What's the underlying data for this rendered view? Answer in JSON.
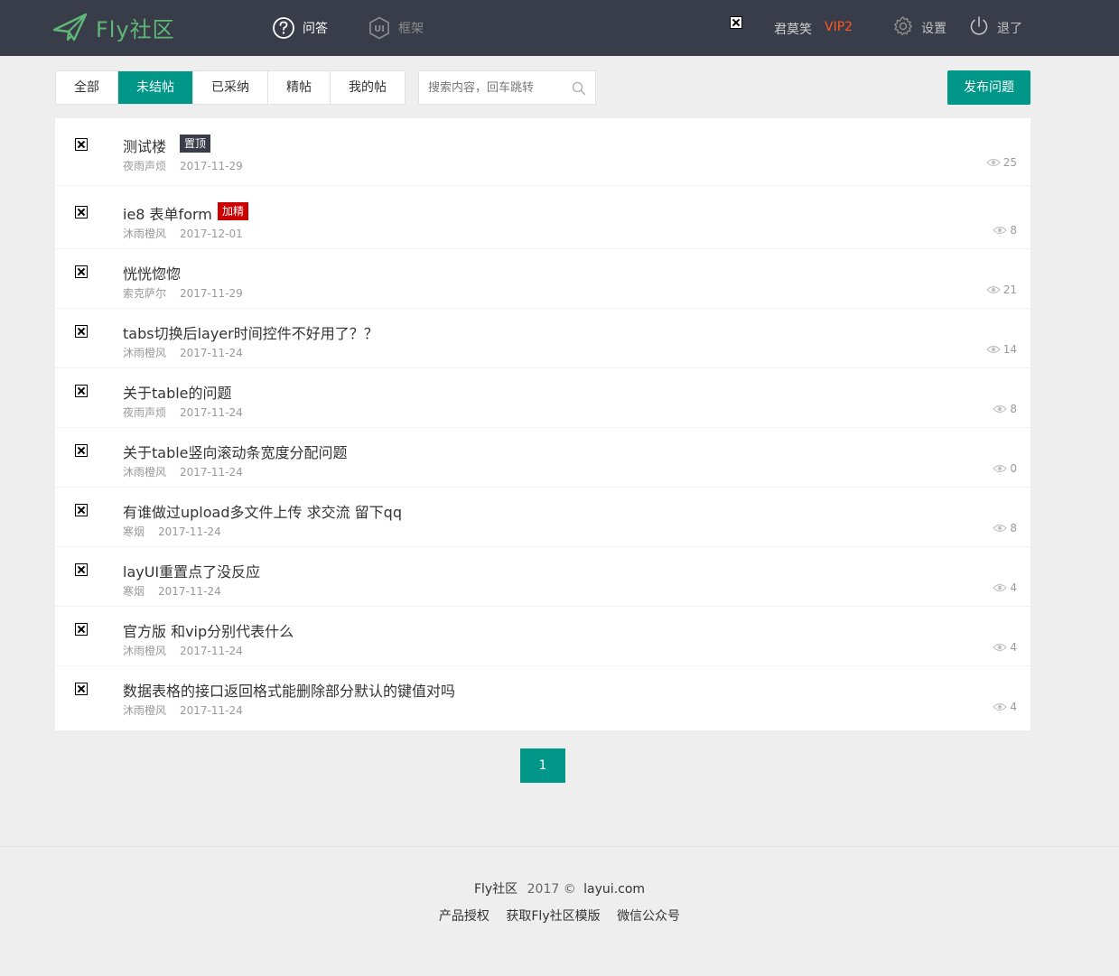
{
  "header": {
    "logo_text": "Fly社区",
    "nav": {
      "qa": "问答",
      "framework": "框架"
    },
    "user": {
      "name": "君莫笑",
      "vip": "VIP2"
    },
    "settings": "设置",
    "logout": "退了"
  },
  "filters": {
    "tabs": [
      "全部",
      "未结帖",
      "已采纳",
      "精帖",
      "我的帖"
    ],
    "active_tab": "未结帖",
    "search_placeholder": "搜索内容，回车跳转",
    "post_button": "发布问题"
  },
  "posts": [
    {
      "title": "测试楼",
      "badge": "置顶",
      "badge_type": "top",
      "author": "夜雨声烦",
      "date": "2017-11-29",
      "views": "25"
    },
    {
      "title": "ie8 表单form",
      "badge": "加精",
      "badge_type": "fine",
      "author": "沐雨橙风",
      "date": "2017-12-01",
      "views": "8"
    },
    {
      "title": "恍恍惚惚",
      "author": "索克萨尔",
      "date": "2017-11-29",
      "views": "21"
    },
    {
      "title": "tabs切换后layer时间控件不好用了？？",
      "author": "沐雨橙风",
      "date": "2017-11-24",
      "views": "14"
    },
    {
      "title": "关于table的问题",
      "author": "夜雨声烦",
      "date": "2017-11-24",
      "views": "8"
    },
    {
      "title": "关于table竖向滚动条宽度分配问题",
      "author": "沐雨橙风",
      "date": "2017-11-24",
      "views": "0"
    },
    {
      "title": "有谁做过upload多文件上传 求交流 留下qq",
      "author": "寒烟",
      "date": "2017-11-24",
      "views": "8"
    },
    {
      "title": "layUI重置点了没反应",
      "author": "寒烟",
      "date": "2017-11-24",
      "views": "4"
    },
    {
      "title": "官方版 和vip分别代表什么",
      "author": "沐雨橙风",
      "date": "2017-11-24",
      "views": "4"
    },
    {
      "title": "数据表格的接口返回格式能删除部分默认的键值对吗",
      "author": "沐雨橙风",
      "date": "2017-11-24",
      "views": "4"
    }
  ],
  "pager": {
    "current": "1"
  },
  "footer": {
    "site": "Fly社区",
    "year": "2017 ©",
    "domain": "layui.com",
    "links": [
      "产品授权",
      "获取Fly社区模版",
      "微信公众号"
    ]
  },
  "colors": {
    "header_bg": "#393d49",
    "accent": "#009688",
    "logo": "#5fb878",
    "vip": "#ff5722",
    "badge_fine": "#cc0000"
  },
  "icons": [
    "paper-plane-icon",
    "question-icon",
    "ui-icon",
    "gear-icon",
    "power-icon",
    "search-icon",
    "eye-icon"
  ]
}
